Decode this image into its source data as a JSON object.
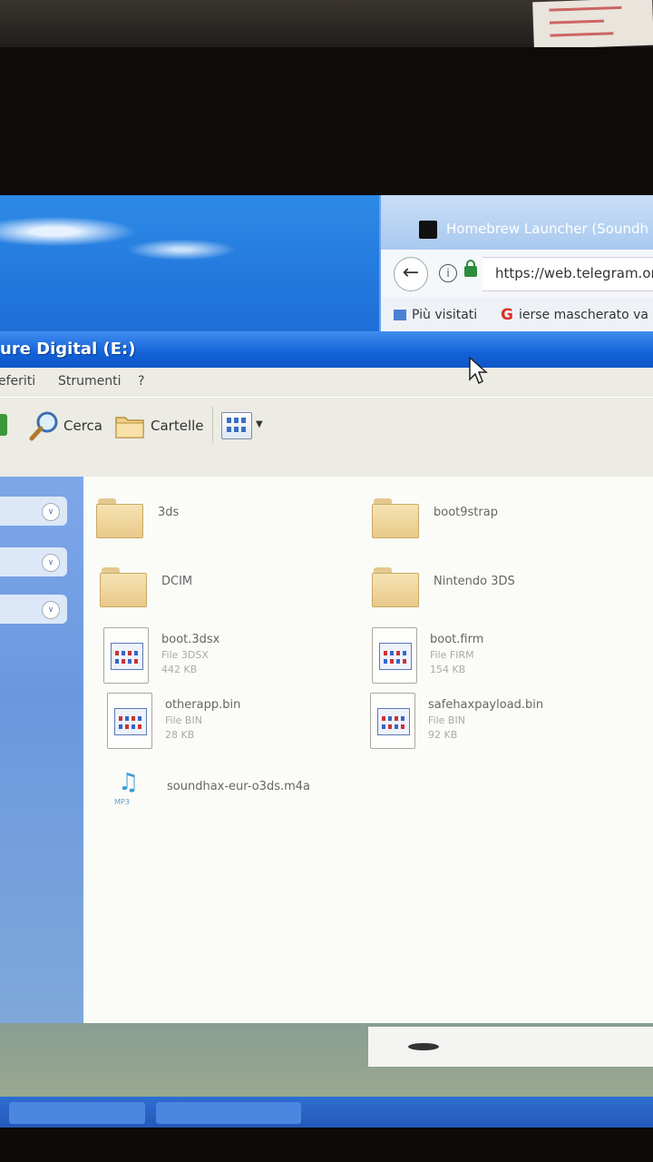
{
  "browser": {
    "tab_title": "Homebrew Launcher (Soundh",
    "url": "https://web.telegram.or",
    "bookmarks": [
      "Più visitati",
      "ierse mascherato va"
    ]
  },
  "explorer": {
    "title": "ure Digital (E:)",
    "menu": [
      "eferiti",
      "Strumenti",
      "?"
    ],
    "toolbar": {
      "search_label": "Cerca",
      "folders_label": "Cartelle"
    },
    "folders": [
      {
        "name": "3ds"
      },
      {
        "name": "boot9strap"
      },
      {
        "name": "DCIM"
      },
      {
        "name": "Nintendo 3DS"
      }
    ],
    "files": [
      {
        "name": "boot.3dsx",
        "type": "File 3DSX",
        "size": "442 KB"
      },
      {
        "name": "boot.firm",
        "type": "File FIRM",
        "size": "154 KB"
      },
      {
        "name": "otherapp.bin",
        "type": "File BIN",
        "size": "28 KB"
      },
      {
        "name": "safehaxpayload.bin",
        "type": "File BIN",
        "size": "92 KB"
      }
    ],
    "audio_file": {
      "name": "soundhax-eur-o3ds.m4a",
      "badge": "MP3"
    }
  }
}
